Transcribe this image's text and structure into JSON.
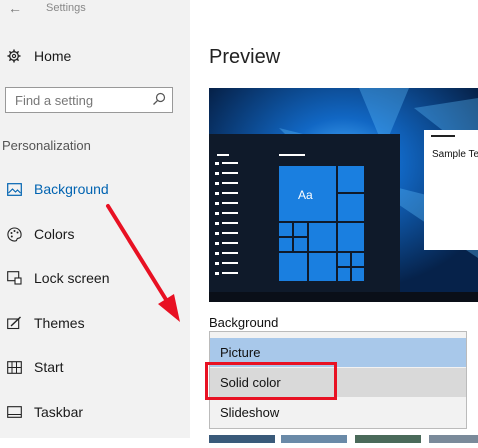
{
  "window": {
    "title": "Settings",
    "back_glyph": "←"
  },
  "sidebar": {
    "home_label": "Home",
    "search_placeholder": "Find a setting",
    "section_label": "Personalization",
    "items": [
      {
        "label": "Background",
        "icon": "picture-icon",
        "active": true
      },
      {
        "label": "Colors",
        "icon": "palette-icon",
        "active": false
      },
      {
        "label": "Lock screen",
        "icon": "lock-screen-icon",
        "active": false
      },
      {
        "label": "Themes",
        "icon": "brush-icon",
        "active": false
      },
      {
        "label": "Start",
        "icon": "start-tiles-icon",
        "active": false
      },
      {
        "label": "Taskbar",
        "icon": "taskbar-icon",
        "active": false
      }
    ]
  },
  "main": {
    "preview_title": "Preview",
    "preview_window": {
      "sample_text": "Sample Te"
    },
    "preview_tile_label": "Aa",
    "background_label": "Background",
    "dropdown": {
      "options": [
        "Picture",
        "Solid color",
        "Slideshow"
      ],
      "hovered": "Picture",
      "highlighted": "Solid color"
    }
  },
  "colors": {
    "accent": "#0078d7",
    "annotation_red": "#e81123"
  }
}
